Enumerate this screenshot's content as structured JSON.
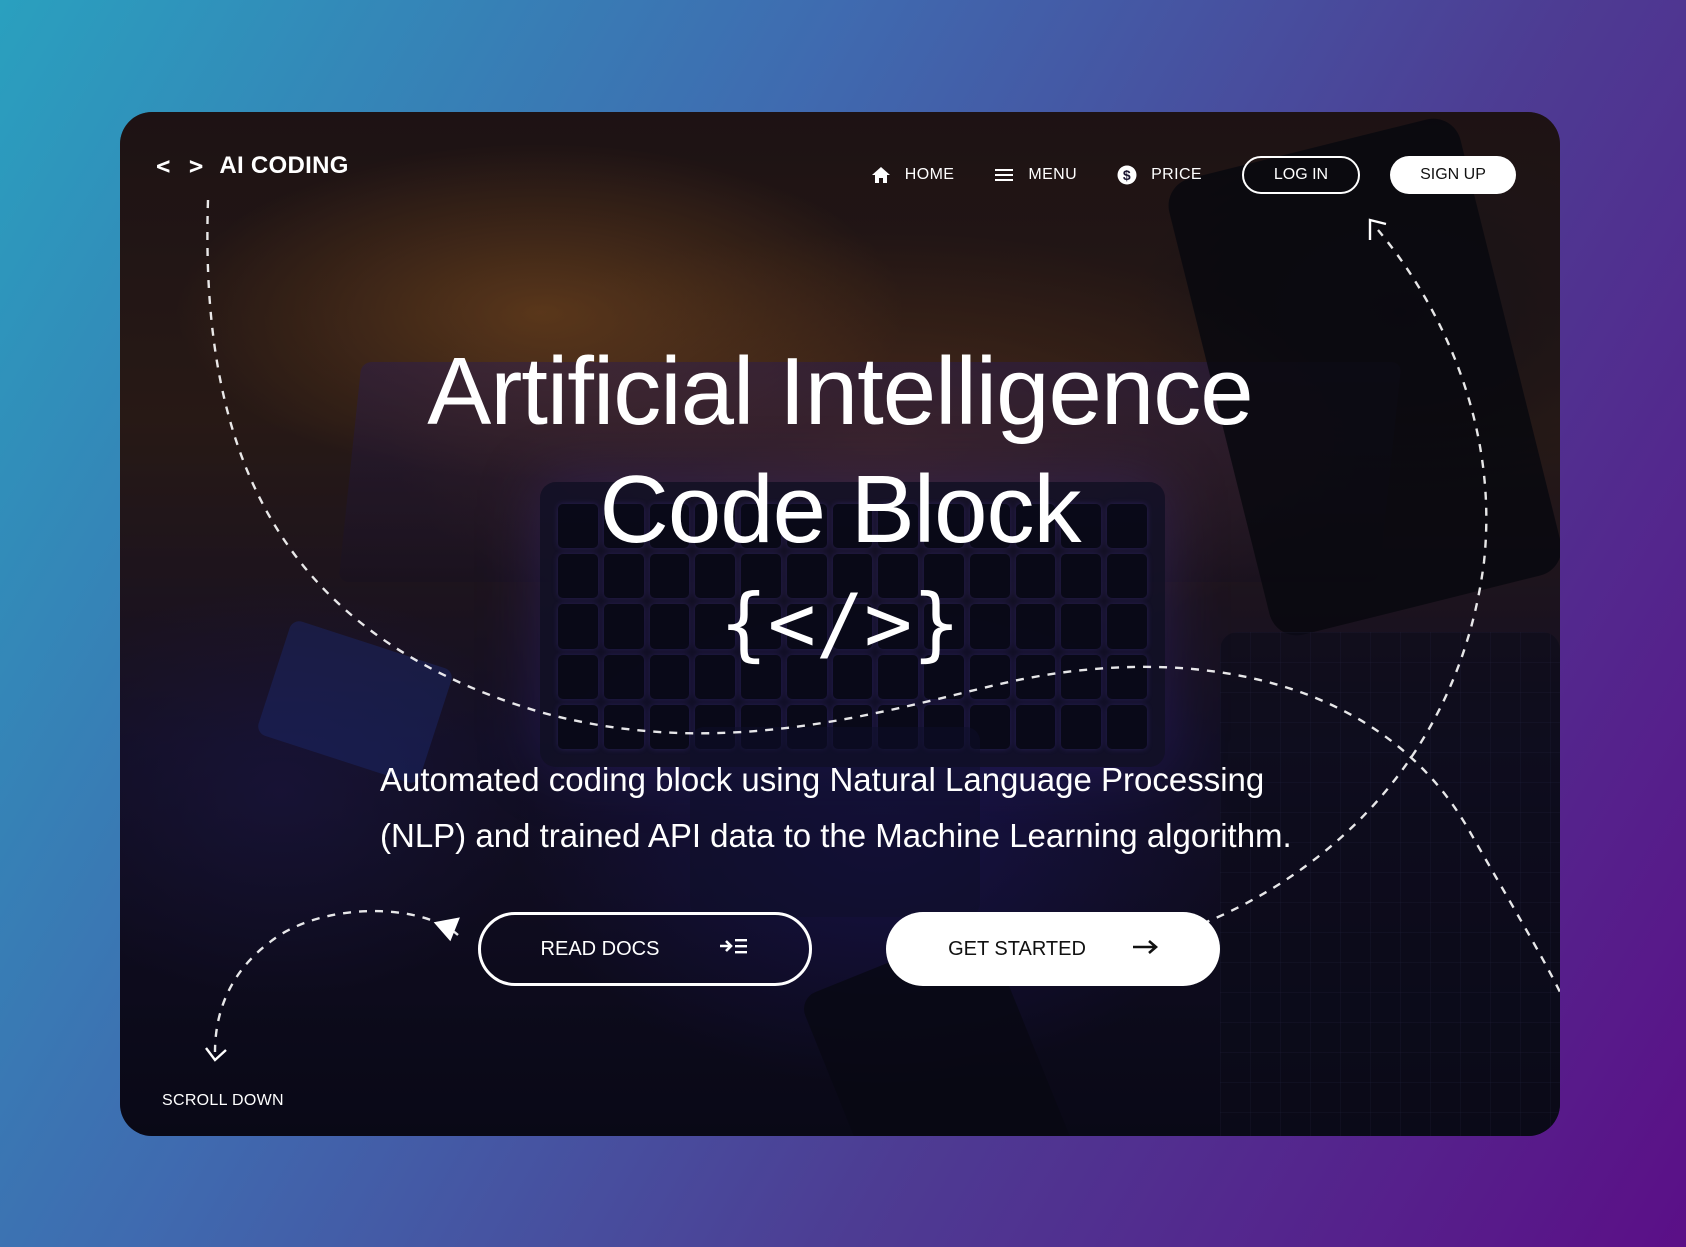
{
  "brand": {
    "icon": "code-brackets-icon",
    "name": "AI CODING"
  },
  "nav": {
    "items": [
      {
        "label": "HOME",
        "icon": "home-icon"
      },
      {
        "label": "MENU",
        "icon": "menu-icon"
      },
      {
        "label": "PRICE",
        "icon": "dollar-icon"
      }
    ],
    "login": "LOG IN",
    "signup": "SIGN UP"
  },
  "hero": {
    "title_line1": "Artificial Intelligence",
    "title_line2": "Code Block",
    "code_symbol": "{</>}",
    "subtitle": "Automated coding block using Natural Language Processing (NLP) and trained API data to the Machine Learning algorithm."
  },
  "actions": {
    "read_docs": "READ DOCS",
    "get_started": "GET STARTED"
  },
  "scroll_down": "SCROLL DOWN",
  "colors": {
    "page_gradient_start": "#2aa0bf",
    "page_gradient_end": "#5b0f87",
    "text": "#ffffff",
    "button_fill": "#ffffff"
  }
}
